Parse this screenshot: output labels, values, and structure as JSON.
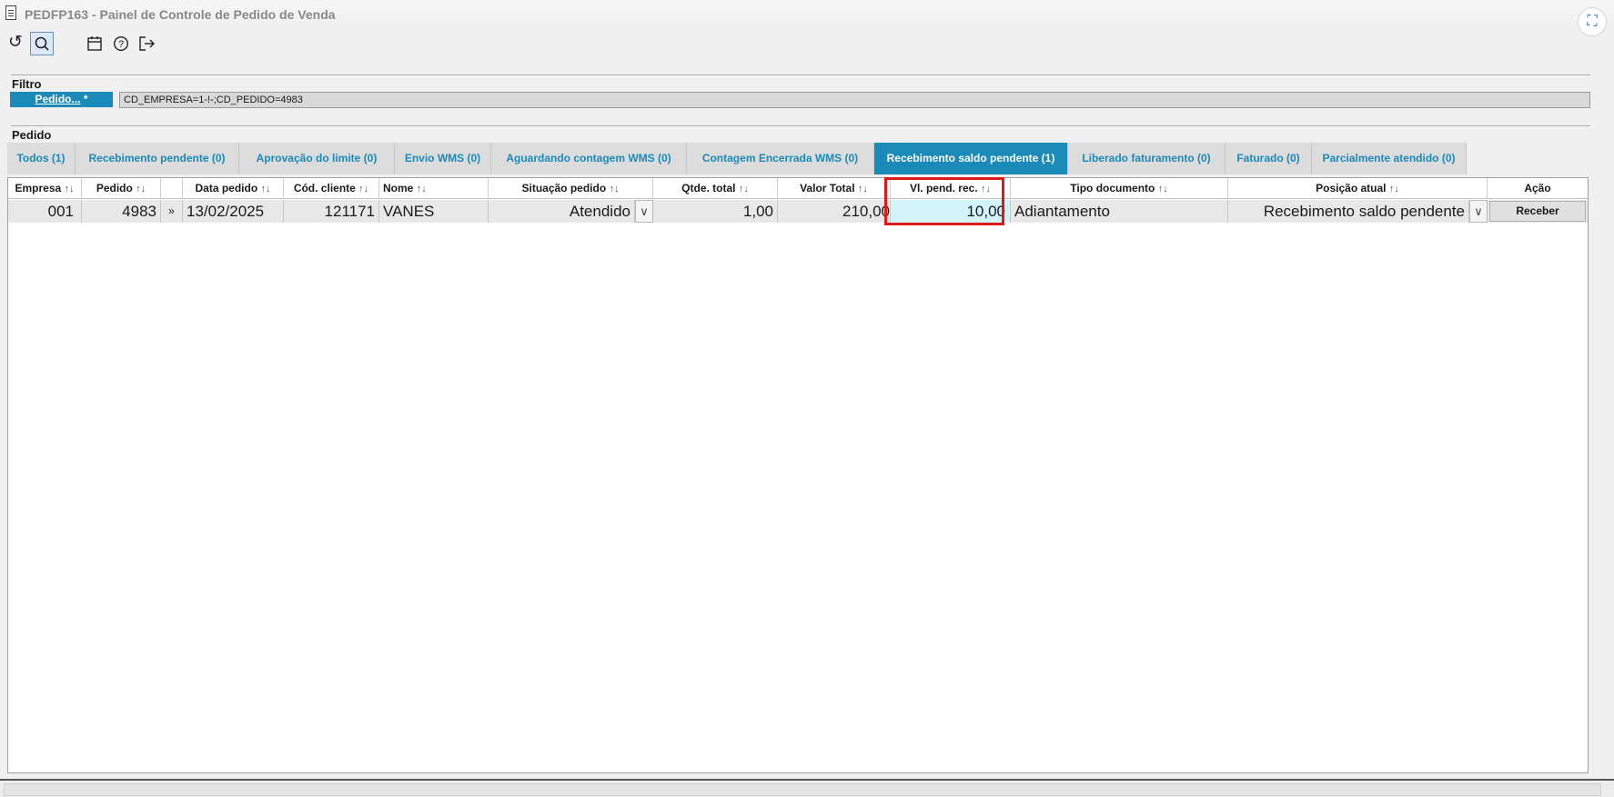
{
  "window": {
    "title": "PEDFP163 - Painel de Controle de Pedido de Venda"
  },
  "toolbar": {
    "icons": [
      "refresh-icon",
      "search-icon",
      "calendar-icon",
      "help-icon",
      "exit-icon"
    ]
  },
  "filter": {
    "section_label": "Filtro",
    "button_label": "Pedido...",
    "button_suffix": " *",
    "value": "CD_EMPRESA=1-!-;CD_PEDIDO=4983"
  },
  "pedido": {
    "section_label": "Pedido"
  },
  "tabs": [
    {
      "label": "Todos (1)"
    },
    {
      "label": "Recebimento pendente (0)"
    },
    {
      "label": "Aprovação do limite (0)"
    },
    {
      "label": "Envio WMS (0)"
    },
    {
      "label": "Aguardando contagem WMS (0)"
    },
    {
      "label": "Contagem Encerrada WMS (0)"
    },
    {
      "label": "Recebimento saldo pendente (1)",
      "active": true
    },
    {
      "label": "Liberado faturamento (0)"
    },
    {
      "label": "Faturado (0)"
    },
    {
      "label": "Parcialmente atendido (0)"
    }
  ],
  "table": {
    "sort_icon": "↑↓",
    "columns": {
      "empresa": "Empresa",
      "pedido": "Pedido",
      "data_pedido": "Data pedido",
      "cod_cliente": "Cód. cliente",
      "nome": "Nome",
      "situacao": "Situação pedido",
      "qtde_total": "Qtde. total",
      "valor_total": "Valor Total",
      "vl_pend_rec": "Vl. pend. rec.",
      "tipo_documento": "Tipo documento",
      "posicao_atual": "Posição atual",
      "acao": "Ação"
    },
    "rows": [
      {
        "empresa": "001",
        "pedido": "4983",
        "expand": "»",
        "data_pedido": "13/02/2025",
        "cod_cliente": "121171",
        "nome": "VANES",
        "situacao": "Atendido",
        "qtde_total": "1,00",
        "valor_total": "210,00",
        "vl_pend_rec": "10,00",
        "tipo_documento": "Adiantamento",
        "posicao_atual": "Recebimento saldo pendente",
        "acao": "Receber"
      }
    ]
  },
  "colors": {
    "accent": "#1a8ab8",
    "highlight_cell": "#d3f3fa",
    "annotation_box": "#e01818"
  }
}
